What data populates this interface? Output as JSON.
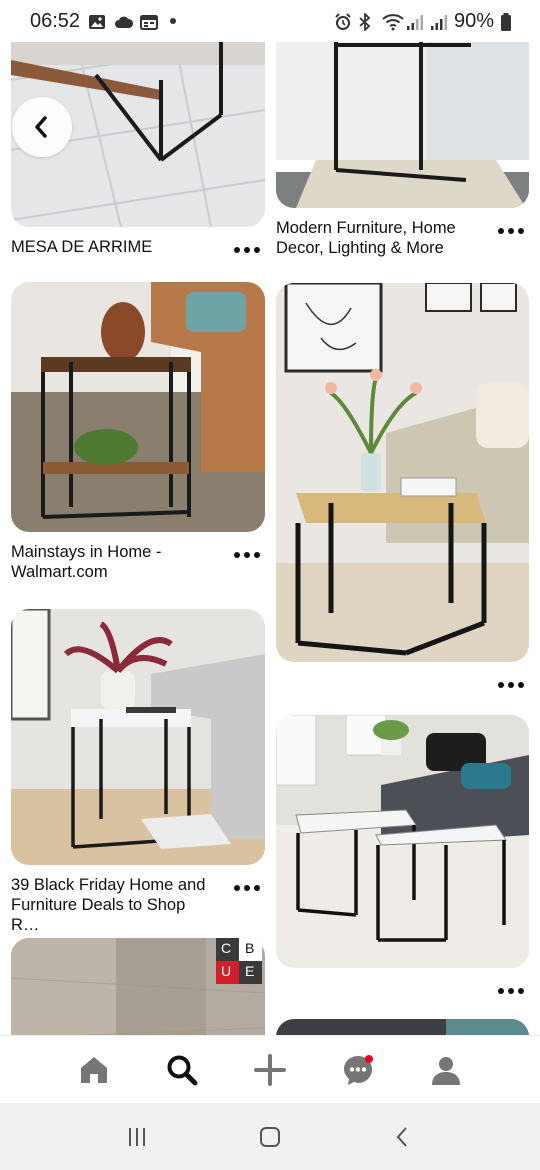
{
  "status_bar": {
    "time": "06:52",
    "battery": "90%"
  },
  "pins": [
    {
      "title": "MESA DE ARRIME",
      "more_label": "More options"
    },
    {
      "title": "Modern Furniture, Home Decor, Lighting & More",
      "more_label": "More options"
    },
    {
      "title": "Mainstays in Home - Walmart.com",
      "more_label": "More options"
    },
    {
      "title": "",
      "more_label": "More options"
    },
    {
      "title": "39 Black Friday Home and Furniture Deals to Shop R…",
      "more_label": "More options"
    },
    {
      "title": "",
      "more_label": "More options"
    }
  ],
  "brand_tile": {
    "letters": [
      "C",
      "B",
      "U",
      "E"
    ]
  },
  "bottom_nav": [
    {
      "name": "home",
      "icon": "home-icon"
    },
    {
      "name": "search",
      "icon": "search-icon",
      "active": true
    },
    {
      "name": "create",
      "icon": "plus-icon"
    },
    {
      "name": "messages",
      "icon": "chat-icon",
      "badge": true
    },
    {
      "name": "profile",
      "icon": "user-icon"
    }
  ],
  "colors": {
    "accent": "#e60023",
    "text": "#111111",
    "nav_icon": "#767676",
    "system_bar": "#f1f1f3"
  }
}
